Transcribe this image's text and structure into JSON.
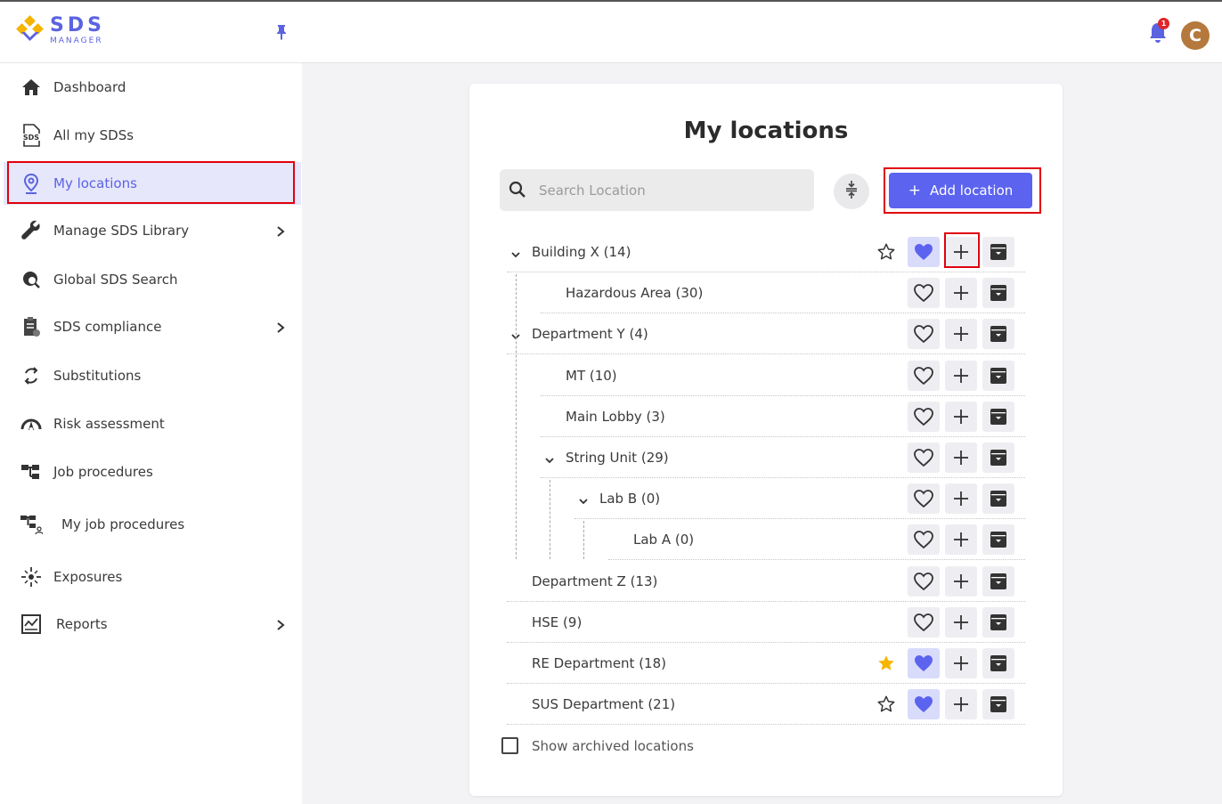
{
  "app": {
    "logo_title": "SDS",
    "logo_subtitle": "MANAGER",
    "notification_count": "1",
    "avatar_initial": "C",
    "accent_color": "#5b63ef",
    "highlight_color": "#e1000f"
  },
  "sidebar": {
    "items": [
      {
        "label": "Dashboard",
        "icon": "home-icon",
        "active": false,
        "has_arrow": false
      },
      {
        "label": "All my SDSs",
        "icon": "sds-document-icon",
        "active": false,
        "has_arrow": false
      },
      {
        "label": "My locations",
        "icon": "location-pin-icon",
        "active": true,
        "has_arrow": false
      },
      {
        "label": "Manage SDS Library",
        "icon": "wrench-icon",
        "active": false,
        "has_arrow": true
      },
      {
        "label": "Global SDS Search",
        "icon": "globe-search-icon",
        "active": false,
        "has_arrow": false
      },
      {
        "label": "SDS compliance",
        "icon": "clipboard-icon",
        "active": false,
        "has_arrow": true
      },
      {
        "label": "Substitutions",
        "icon": "substitution-icon",
        "active": false,
        "has_arrow": false
      },
      {
        "label": "Risk assessment",
        "icon": "gauge-icon",
        "active": false,
        "has_arrow": false
      },
      {
        "label": "Job procedures",
        "icon": "hierarchy-icon",
        "active": false,
        "has_arrow": false
      },
      {
        "label": "My job procedures",
        "icon": "user-hierarchy-icon",
        "active": false,
        "has_arrow": false
      },
      {
        "label": "Exposures",
        "icon": "exposure-icon",
        "active": false,
        "has_arrow": false
      },
      {
        "label": "Reports",
        "icon": "report-chart-icon",
        "active": false,
        "has_arrow": true
      }
    ]
  },
  "main": {
    "title": "My locations",
    "search_placeholder": "Search Location",
    "add_button": "Add location",
    "add_button_symbol": "+",
    "show_archived_label": "Show archived locations",
    "locations": [
      {
        "label": "Building X (14)",
        "depth": 0,
        "expandable": true,
        "star": "outline",
        "favorite": true
      },
      {
        "label": "Hazardous Area (30)",
        "depth": 1,
        "expandable": false,
        "star": "none",
        "favorite": false
      },
      {
        "label": "Department Y (4)",
        "depth": 0,
        "expandable": true,
        "star": "none",
        "favorite": false
      },
      {
        "label": "MT (10)",
        "depth": 1,
        "expandable": false,
        "star": "none",
        "favorite": false
      },
      {
        "label": "Main Lobby (3)",
        "depth": 1,
        "expandable": false,
        "star": "none",
        "favorite": false
      },
      {
        "label": "String Unit (29)",
        "depth": 1,
        "expandable": true,
        "star": "none",
        "favorite": false
      },
      {
        "label": "Lab B (0)",
        "depth": 2,
        "expandable": true,
        "star": "none",
        "favorite": false
      },
      {
        "label": "Lab A (0)",
        "depth": 3,
        "expandable": false,
        "star": "none",
        "favorite": false
      },
      {
        "label": "Department Z (13)",
        "depth": 0,
        "expandable": false,
        "star": "none",
        "favorite": false
      },
      {
        "label": "HSE (9)",
        "depth": 0,
        "expandable": false,
        "star": "none",
        "favorite": false
      },
      {
        "label": "RE Department (18)",
        "depth": 0,
        "expandable": false,
        "star": "filled",
        "favorite": true
      },
      {
        "label": "SUS Department (21)",
        "depth": 0,
        "expandable": false,
        "star": "outline",
        "favorite": true
      }
    ]
  }
}
